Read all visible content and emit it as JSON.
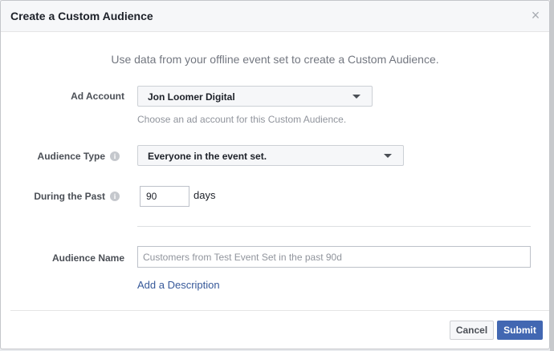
{
  "dialog": {
    "title": "Create a Custom Audience",
    "close_glyph": "×",
    "intro": "Use data from your offline event set to create a Custom Audience."
  },
  "ad_account": {
    "label": "Ad Account",
    "value": "Jon Loomer Digital",
    "helper": "Choose an ad account for this Custom Audience."
  },
  "audience_type": {
    "label": "Audience Type",
    "value": "Everyone in the event set."
  },
  "during_past": {
    "label": "During the Past",
    "value": "90",
    "unit": "days"
  },
  "audience_name": {
    "label": "Audience Name",
    "placeholder": "Customers from Test Event Set in the past 90d",
    "add_description": "Add a Description"
  },
  "footer": {
    "cancel": "Cancel",
    "submit": "Submit"
  },
  "icons": {
    "info": "i"
  },
  "colors": {
    "primary": "#4267b2",
    "link": "#365899"
  }
}
